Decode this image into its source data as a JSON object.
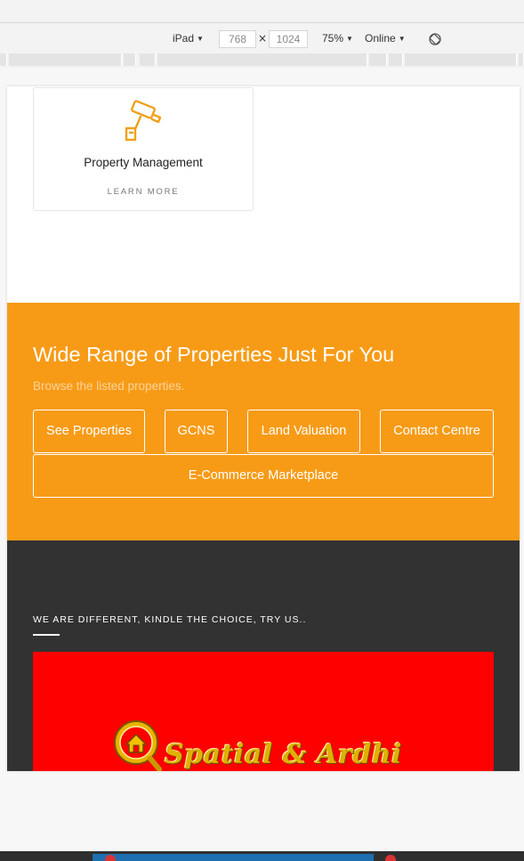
{
  "devtools": {
    "device": "iPad",
    "width": "768",
    "times": "×",
    "height": "1024",
    "zoom": "75%",
    "network": "Online",
    "caret": "▼",
    "rotate_icon": "rotate-icon"
  },
  "service_card": {
    "icon": "security-camera-icon",
    "title": "Property Management",
    "link": "LEARN MORE"
  },
  "properties_band": {
    "title": "Wide Range of Properties Just For You",
    "subtitle": "Browse the listed properties.",
    "buttons": {
      "see_properties": "See Properties",
      "gcns": "GCNS",
      "land_valuation": "Land Valuation",
      "contact_centre": "Contact Centre",
      "ecommerce": "E-Commerce Marketplace"
    }
  },
  "footer_band": {
    "tagline": "WE ARE DIFFERENT, KINDLE THE CHOICE, TRY US..",
    "logo_text": "Spatial & Ardhi"
  },
  "colors": {
    "accent_orange": "#f79b17",
    "dark_band": "#323232",
    "banner_red": "#ff0000",
    "logo_gold": "#e0b100"
  }
}
